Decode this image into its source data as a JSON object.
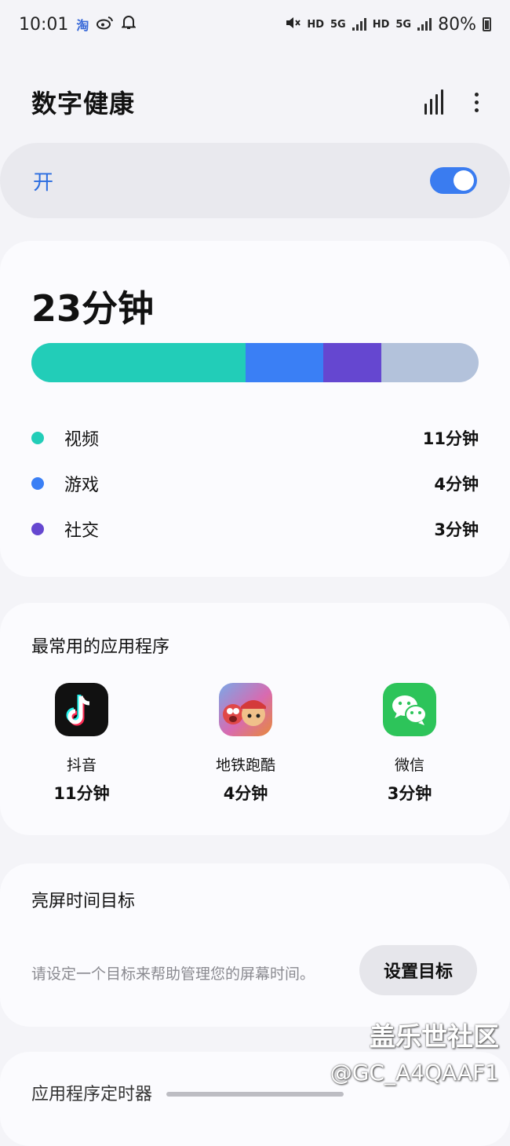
{
  "status_bar": {
    "time": "10:01",
    "app_icons": [
      "taobao-icon",
      "weibo-icon",
      "bell-icon"
    ],
    "taobao_text": "淘",
    "hd1": "HD",
    "net1": "5G",
    "hd2": "HD",
    "net2": "5G",
    "battery": "80%"
  },
  "header": {
    "title": "数字健康"
  },
  "master_toggle": {
    "label": "开",
    "state": "on"
  },
  "usage": {
    "total": "23分钟",
    "categories": [
      {
        "name": "视频",
        "time": "11分钟",
        "minutes": 11,
        "color": "#22cdb8"
      },
      {
        "name": "游戏",
        "time": "4分钟",
        "minutes": 4,
        "color": "#3a7ff5"
      },
      {
        "name": "社交",
        "time": "3分钟",
        "minutes": 3,
        "color": "#6547d0"
      }
    ],
    "other_color": "#b3c2db"
  },
  "apps": {
    "title": "最常用的应用程序",
    "items": [
      {
        "name": "抖音",
        "time": "11分钟"
      },
      {
        "name": "地铁跑酷",
        "time": "4分钟"
      },
      {
        "name": "微信",
        "time": "3分钟"
      }
    ]
  },
  "goal": {
    "title": "亮屏时间目标",
    "description": "请设定一个目标来帮助管理您的屏幕时间。",
    "button": "设置目标"
  },
  "next_section": {
    "title": "应用程序定时器"
  },
  "watermark": {
    "site": "盖乐世社区",
    "handle": "@GC_A4QAAF1"
  }
}
